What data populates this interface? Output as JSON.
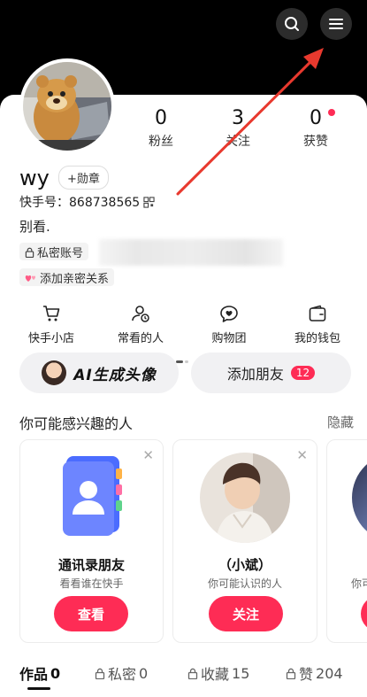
{
  "header": {
    "search_icon": "search-icon",
    "menu_icon": "menu-icon"
  },
  "profile": {
    "name": "wy",
    "badge": "+勋章",
    "uid_label": "快手号：868738565",
    "bio": "别看.",
    "tags": [
      "私密账号",
      "添加亲密关系"
    ]
  },
  "stats": [
    {
      "num": "0",
      "label": "粉丝"
    },
    {
      "num": "3",
      "label": "关注"
    },
    {
      "num": "0",
      "label": "获赞"
    }
  ],
  "shortcuts": [
    {
      "label": "快手小店",
      "icon": "cart-icon"
    },
    {
      "label": "常看的人",
      "icon": "person-clock-icon"
    },
    {
      "label": "购物团",
      "icon": "heart-chat-icon"
    },
    {
      "label": "我的钱包",
      "icon": "wallet-icon"
    }
  ],
  "pills": {
    "ai_label": "AI生成头像",
    "friend_label": "添加朋友",
    "friend_count": "12"
  },
  "recommend": {
    "title": "你可能感兴趣的人",
    "hide": "隐藏",
    "cards": [
      {
        "title": "通讯录朋友",
        "sub": "看看谁在快手",
        "button": "查看"
      },
      {
        "title": "（小斌）",
        "sub": "你可能认识的人",
        "button": "关注"
      },
      {
        "sub": "你可"
      }
    ]
  },
  "tabs": [
    {
      "label": "作品",
      "count": "0"
    },
    {
      "label": "私密",
      "count": "0"
    },
    {
      "label": "收藏",
      "count": "15"
    },
    {
      "label": "赞",
      "count": "204"
    }
  ],
  "colors": {
    "accent": "#fe2c55",
    "annotation_arrow": "#e8392e"
  }
}
